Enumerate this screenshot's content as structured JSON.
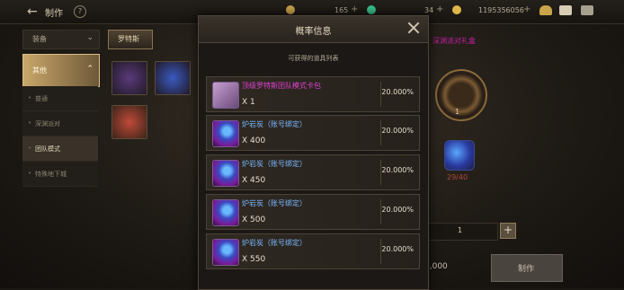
{
  "header": {
    "title": "制作",
    "back_icon": "back-arrow-icon",
    "help_label": "?",
    "resources": [
      {
        "value": "165",
        "icon": "coin-icon",
        "color": "#c9a44a"
      },
      {
        "value": "34",
        "icon": "gem-icon",
        "color": "#3ac08a"
      },
      {
        "value": "1195356056",
        "icon": "gold-icon",
        "color": "#e0b84a"
      }
    ],
    "plus_label": "+"
  },
  "sidebar": {
    "dropdown_label": "装备",
    "active_label": "其他",
    "items": [
      {
        "label": "普通"
      },
      {
        "label": "深渊派对"
      },
      {
        "label": "团队模式",
        "selected": true
      },
      {
        "label": "特殊地下城"
      }
    ]
  },
  "content": {
    "tab_label": "罗特斯"
  },
  "modal": {
    "title": "概率信息",
    "subtitle": "可获得的道具列表",
    "rows": [
      {
        "name": "顶级罗特斯团队模式卡包",
        "qty": "X 1",
        "pct": "20.000%",
        "name_color": "#e040d0",
        "icon": "card-pack-icon"
      },
      {
        "name": "炉岩炭（账号绑定）",
        "qty": "X 400",
        "pct": "20.000%",
        "name_color": "#7ab8ff",
        "icon": "ore-icon"
      },
      {
        "name": "炉岩炭（账号绑定）",
        "qty": "X 450",
        "pct": "20.000%",
        "name_color": "#7ab8ff",
        "icon": "ore-icon"
      },
      {
        "name": "炉岩炭（账号绑定）",
        "qty": "X 500",
        "pct": "20.000%",
        "name_color": "#7ab8ff",
        "icon": "ore-icon"
      },
      {
        "name": "炉岩炭（账号绑定）",
        "qty": "X 550",
        "pct": "20.000%",
        "name_color": "#7ab8ff",
        "icon": "ore-icon"
      }
    ]
  },
  "right_panel": {
    "title": "深渊派对礼盒",
    "result_count": "1",
    "material_count": "29/40",
    "quantity": "1",
    "cost": "0,000",
    "make_button": "制作",
    "plus_label": "+"
  }
}
